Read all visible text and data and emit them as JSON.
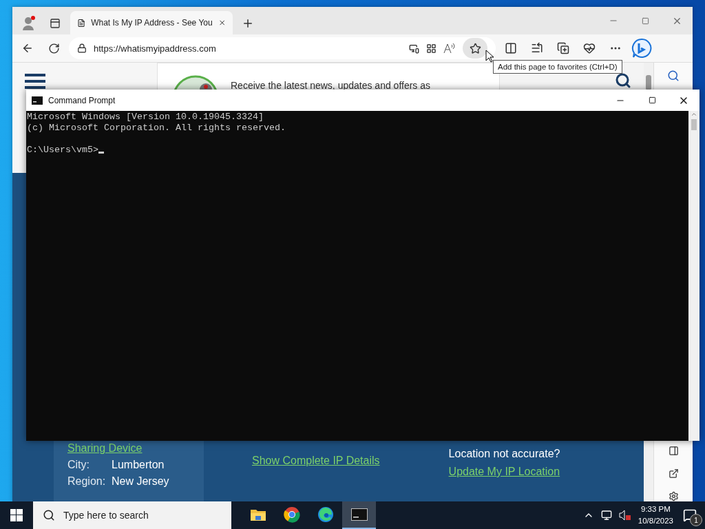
{
  "browser": {
    "tabs": [
      {
        "title": "What Is My IP Address - See You",
        "selected": true
      }
    ],
    "url": "https://whatismyipaddress.com",
    "tooltip": "Add this page to favorites (Ctrl+D)",
    "page": {
      "banner_text": "Receive the latest news, updates and offers as",
      "sharing_link": "Sharing Device",
      "fields": [
        {
          "label": "City:",
          "value": "Lumberton"
        },
        {
          "label": "Region:",
          "value": "New Jersey"
        }
      ],
      "details_link": "Show Complete IP Details",
      "location_question": "Location not accurate?",
      "update_link": "Update My IP Location"
    }
  },
  "console": {
    "title": "Command Prompt",
    "lines": [
      "Microsoft Windows [Version 10.0.19045.3324]",
      "(c) Microsoft Corporation. All rights reserved."
    ],
    "prompt": "C:\\Users\\vm5>"
  },
  "taskbar": {
    "search_placeholder": "Type here to search",
    "apps": [
      {
        "kind": "folder",
        "selected": false
      },
      {
        "kind": "chrome",
        "selected": false
      },
      {
        "kind": "edge",
        "selected": false
      },
      {
        "kind": "console",
        "selected": true
      }
    ],
    "time": "9:33 PM",
    "date": "10/8/2023",
    "notification_count": "1"
  }
}
